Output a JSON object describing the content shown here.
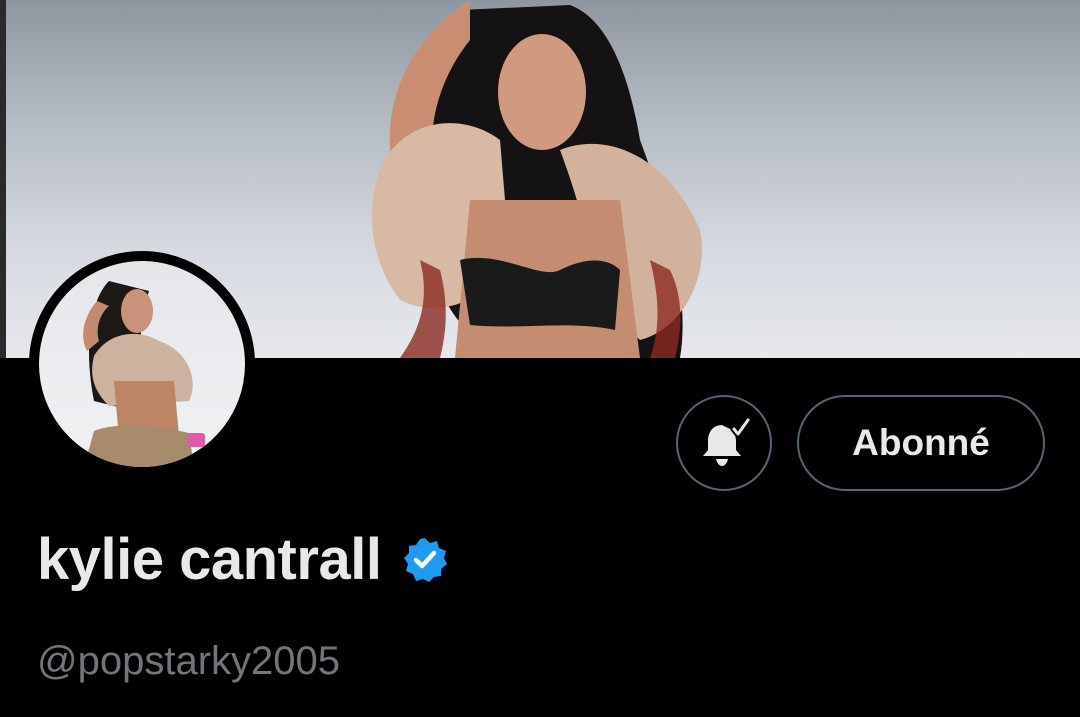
{
  "banner": {
    "icon": "banner-photo"
  },
  "avatar": {
    "icon": "avatar-photo"
  },
  "actions": {
    "notifications_icon": "bell-check-icon",
    "follow_label": "Abonné"
  },
  "profile": {
    "display_name": "kylie cantrall",
    "verified_icon": "verified-badge-icon",
    "handle": "@popstarky2005"
  },
  "colors": {
    "background": "#000000",
    "text_primary": "#e7e9ea",
    "text_secondary": "#71767b",
    "border": "#536471",
    "verified": "#1d9bf0"
  }
}
